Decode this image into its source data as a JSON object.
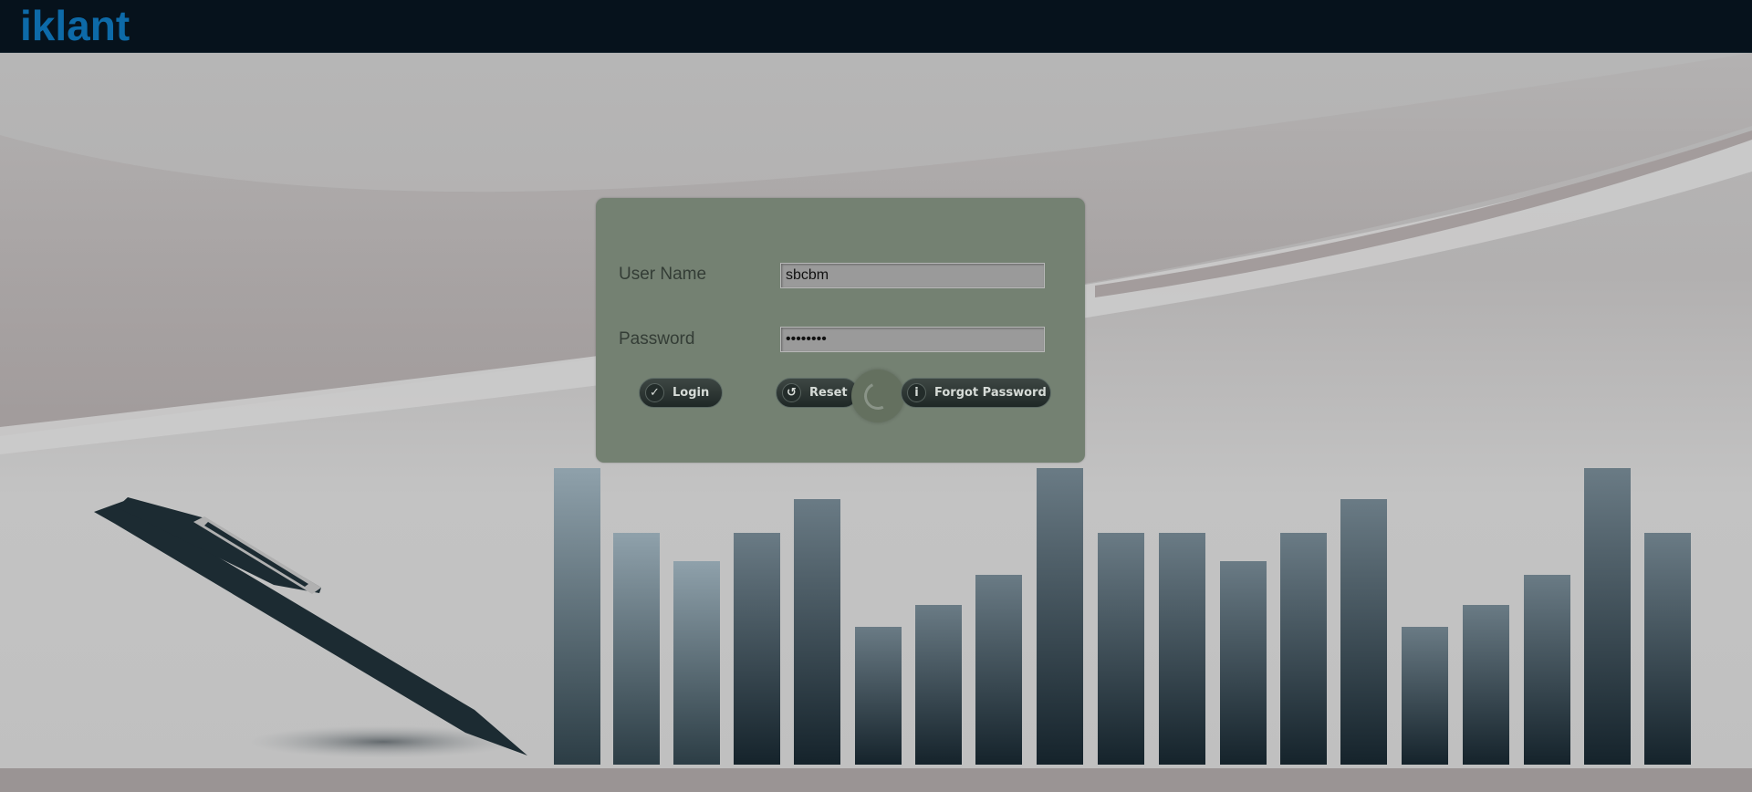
{
  "header": {
    "logo_text": "iklant"
  },
  "login": {
    "username_label": "User Name",
    "username_value": "sbcbm",
    "password_label": "Password",
    "password_value": "sbcbm123",
    "login_button": "Login",
    "reset_button": "Reset",
    "forgot_button": "Forgot Password"
  },
  "icons": {
    "login": "check-icon",
    "reset": "undo-icon",
    "forgot": "info-icon",
    "loading": "spinner-icon"
  },
  "colors": {
    "topbar": "#06121c",
    "logo": "#0d6aa8",
    "panel": "#748172",
    "button": "#2b3532"
  }
}
